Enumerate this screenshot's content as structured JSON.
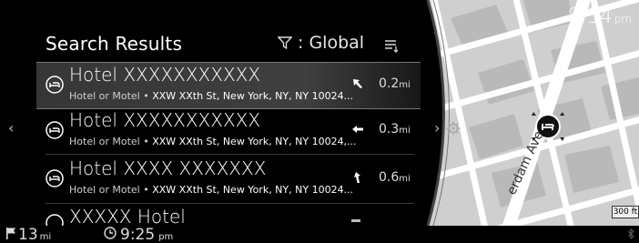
{
  "header": {
    "title": "Search Results",
    "filter_label": ": Global"
  },
  "clock": {
    "time": "8:54",
    "ampm": "pm"
  },
  "results": [
    {
      "name": "Hotel XXXXXXXXXXX",
      "category": "Hotel or Motel",
      "address": "XXW XXth St, New York, NY, NY 10024...",
      "distance": "0.2",
      "unit": "mi",
      "direction": "northwest"
    },
    {
      "name": "Hotel XXXXXXXXXXX",
      "category": "Hotel or Motel",
      "address": "XXW XXth St, New York, NY, NY 10024,...",
      "distance": "0.3",
      "unit": "mi",
      "direction": "west"
    },
    {
      "name": "Hotel XXXX XXXXXXX",
      "category": "Hotel or Motel",
      "address": "XXW XXth St, New York, NY, NY 10024...",
      "distance": "0.6",
      "unit": "mi",
      "direction": "north-northwest"
    },
    {
      "name": "XXXXX Hotel",
      "distance": ""
    }
  ],
  "map": {
    "street_label": "erdam Ave",
    "scale": "300 ft"
  },
  "status": {
    "odometer": "13",
    "odometer_unit": "mi",
    "eta": "9:25",
    "eta_ampm": "pm"
  },
  "icons": {
    "filter": "filter-icon",
    "sort": "sort-icon",
    "poi": "hotel-bed-icon",
    "settings": "gear-icon",
    "flag": "flag-icon",
    "clock": "clock-icon",
    "bluetooth": "bluetooth-icon"
  }
}
